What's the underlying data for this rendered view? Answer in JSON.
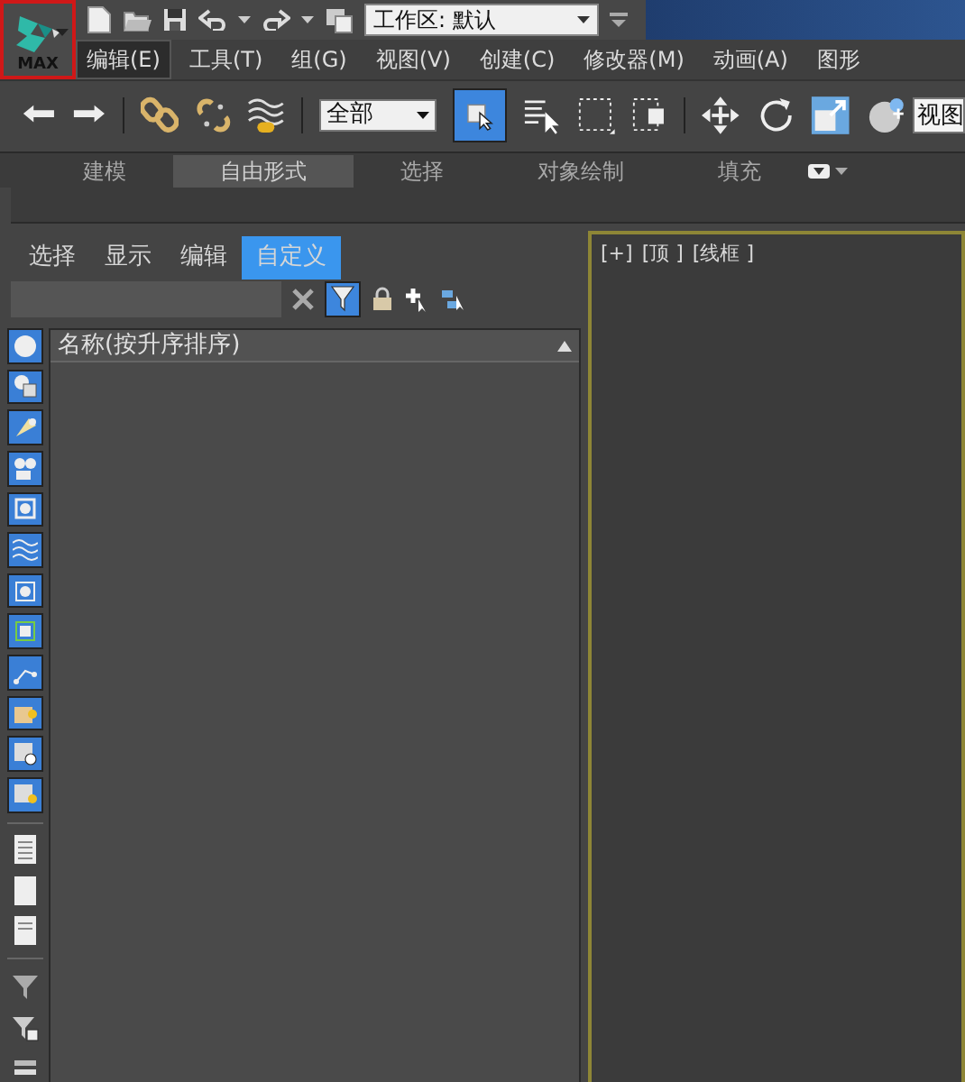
{
  "app_button": {
    "label": "MAX"
  },
  "quick_access": {
    "workspace": "工作区: 默认"
  },
  "menu": [
    {
      "label": "编辑(E)",
      "selected": true
    },
    {
      "label": "工具(T)",
      "selected": false
    },
    {
      "label": "组(G)",
      "selected": false
    },
    {
      "label": "视图(V)",
      "selected": false
    },
    {
      "label": "创建(C)",
      "selected": false
    },
    {
      "label": "修改器(M)",
      "selected": false
    },
    {
      "label": "动画(A)",
      "selected": false
    },
    {
      "label": "图形",
      "selected": false
    }
  ],
  "toolbar": {
    "selection_filter": "全部",
    "select_object_on": true,
    "reference_coordinate": "视图"
  },
  "ribbon": {
    "tabs": [
      {
        "label": "建模",
        "selected": false
      },
      {
        "label": "自由形式",
        "selected": true
      },
      {
        "label": "选择",
        "selected": false
      },
      {
        "label": "对象绘制",
        "selected": false
      },
      {
        "label": "填充",
        "selected": false
      }
    ]
  },
  "explorer": {
    "tabs": [
      {
        "label": "选择",
        "selected": false
      },
      {
        "label": "显示",
        "selected": false
      },
      {
        "label": "编辑",
        "selected": false
      },
      {
        "label": "自定义",
        "selected": true
      }
    ],
    "filter_on": true,
    "column_header": "名称(按升序排序)",
    "filters": [
      {
        "on": true
      },
      {
        "on": true
      },
      {
        "on": true
      },
      {
        "on": true
      },
      {
        "on": true
      },
      {
        "on": true
      },
      {
        "on": true
      },
      {
        "on": true
      },
      {
        "on": true
      },
      {
        "on": true
      },
      {
        "on": true
      },
      {
        "on": true
      }
    ]
  },
  "viewport": {
    "labels": [
      "[+]",
      "[顶 ]",
      "[线框 ]"
    ]
  }
}
